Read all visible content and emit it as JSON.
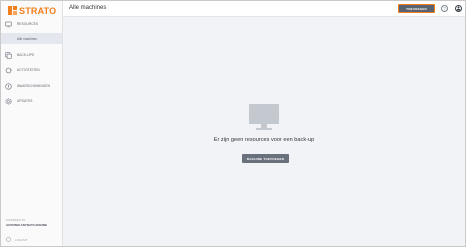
{
  "brand": {
    "name": "STRATO",
    "accent": "#f07f1c"
  },
  "sidebar": {
    "items": [
      {
        "label": "RESOURCES",
        "icon": "monitor-icon"
      },
      {
        "label": "Alle machines"
      },
      {
        "label": "BACK-UPS",
        "icon": "backup-icon"
      },
      {
        "label": "ACTIVITEITEN",
        "icon": "activity-icon"
      },
      {
        "label": "WAARSCHUWINGEN",
        "icon": "alert-icon"
      },
      {
        "label": "UPDATES",
        "icon": "settings-icon"
      }
    ],
    "powered_by": "POWERED BY",
    "engine": "ACRONIS ANYDATA ENGINE",
    "logout": "LOGOUT"
  },
  "header": {
    "title": "Alle machines",
    "add_label": "TOEVOEGEN"
  },
  "main": {
    "empty_message": "Er zijn geen resources voor een back-up",
    "add_machine_label": "MACHINE TOEVOEGEN"
  }
}
